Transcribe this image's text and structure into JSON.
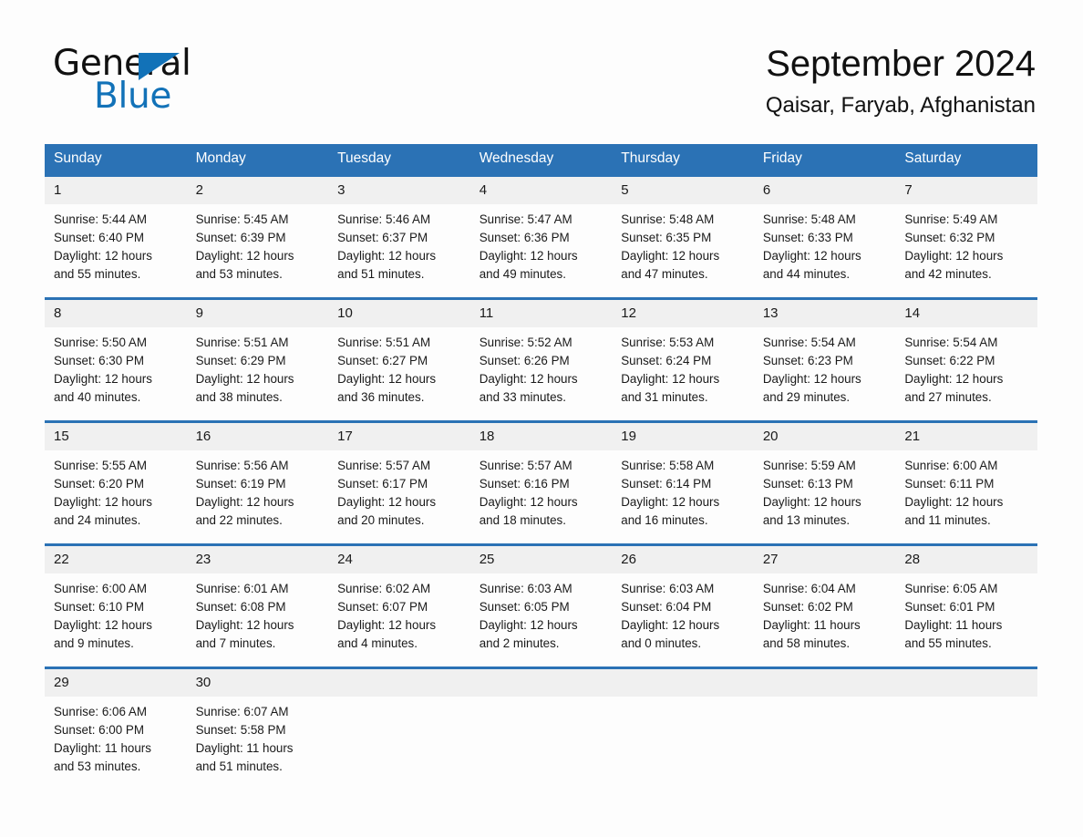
{
  "brand": {
    "name_part1": "General",
    "name_part2": "Blue",
    "triangle_color": "#1272b8"
  },
  "header": {
    "title": "September 2024",
    "location": "Qaisar, Faryab, Afghanistan"
  },
  "theme": {
    "header_blue": "#2b72b5",
    "date_band": "#f0f0f0",
    "page_background": "#fdfdfd",
    "text": "#1a1a1a"
  },
  "weekday_headers": [
    "Sunday",
    "Monday",
    "Tuesday",
    "Wednesday",
    "Thursday",
    "Friday",
    "Saturday"
  ],
  "weeks": [
    {
      "days": [
        {
          "date": "1",
          "sunrise": "Sunrise: 5:44 AM",
          "sunset": "Sunset: 6:40 PM",
          "daylight_line1": "Daylight: 12 hours",
          "daylight_line2": "and 55 minutes."
        },
        {
          "date": "2",
          "sunrise": "Sunrise: 5:45 AM",
          "sunset": "Sunset: 6:39 PM",
          "daylight_line1": "Daylight: 12 hours",
          "daylight_line2": "and 53 minutes."
        },
        {
          "date": "3",
          "sunrise": "Sunrise: 5:46 AM",
          "sunset": "Sunset: 6:37 PM",
          "daylight_line1": "Daylight: 12 hours",
          "daylight_line2": "and 51 minutes."
        },
        {
          "date": "4",
          "sunrise": "Sunrise: 5:47 AM",
          "sunset": "Sunset: 6:36 PM",
          "daylight_line1": "Daylight: 12 hours",
          "daylight_line2": "and 49 minutes."
        },
        {
          "date": "5",
          "sunrise": "Sunrise: 5:48 AM",
          "sunset": "Sunset: 6:35 PM",
          "daylight_line1": "Daylight: 12 hours",
          "daylight_line2": "and 47 minutes."
        },
        {
          "date": "6",
          "sunrise": "Sunrise: 5:48 AM",
          "sunset": "Sunset: 6:33 PM",
          "daylight_line1": "Daylight: 12 hours",
          "daylight_line2": "and 44 minutes."
        },
        {
          "date": "7",
          "sunrise": "Sunrise: 5:49 AM",
          "sunset": "Sunset: 6:32 PM",
          "daylight_line1": "Daylight: 12 hours",
          "daylight_line2": "and 42 minutes."
        }
      ]
    },
    {
      "days": [
        {
          "date": "8",
          "sunrise": "Sunrise: 5:50 AM",
          "sunset": "Sunset: 6:30 PM",
          "daylight_line1": "Daylight: 12 hours",
          "daylight_line2": "and 40 minutes."
        },
        {
          "date": "9",
          "sunrise": "Sunrise: 5:51 AM",
          "sunset": "Sunset: 6:29 PM",
          "daylight_line1": "Daylight: 12 hours",
          "daylight_line2": "and 38 minutes."
        },
        {
          "date": "10",
          "sunrise": "Sunrise: 5:51 AM",
          "sunset": "Sunset: 6:27 PM",
          "daylight_line1": "Daylight: 12 hours",
          "daylight_line2": "and 36 minutes."
        },
        {
          "date": "11",
          "sunrise": "Sunrise: 5:52 AM",
          "sunset": "Sunset: 6:26 PM",
          "daylight_line1": "Daylight: 12 hours",
          "daylight_line2": "and 33 minutes."
        },
        {
          "date": "12",
          "sunrise": "Sunrise: 5:53 AM",
          "sunset": "Sunset: 6:24 PM",
          "daylight_line1": "Daylight: 12 hours",
          "daylight_line2": "and 31 minutes."
        },
        {
          "date": "13",
          "sunrise": "Sunrise: 5:54 AM",
          "sunset": "Sunset: 6:23 PM",
          "daylight_line1": "Daylight: 12 hours",
          "daylight_line2": "and 29 minutes."
        },
        {
          "date": "14",
          "sunrise": "Sunrise: 5:54 AM",
          "sunset": "Sunset: 6:22 PM",
          "daylight_line1": "Daylight: 12 hours",
          "daylight_line2": "and 27 minutes."
        }
      ]
    },
    {
      "days": [
        {
          "date": "15",
          "sunrise": "Sunrise: 5:55 AM",
          "sunset": "Sunset: 6:20 PM",
          "daylight_line1": "Daylight: 12 hours",
          "daylight_line2": "and 24 minutes."
        },
        {
          "date": "16",
          "sunrise": "Sunrise: 5:56 AM",
          "sunset": "Sunset: 6:19 PM",
          "daylight_line1": "Daylight: 12 hours",
          "daylight_line2": "and 22 minutes."
        },
        {
          "date": "17",
          "sunrise": "Sunrise: 5:57 AM",
          "sunset": "Sunset: 6:17 PM",
          "daylight_line1": "Daylight: 12 hours",
          "daylight_line2": "and 20 minutes."
        },
        {
          "date": "18",
          "sunrise": "Sunrise: 5:57 AM",
          "sunset": "Sunset: 6:16 PM",
          "daylight_line1": "Daylight: 12 hours",
          "daylight_line2": "and 18 minutes."
        },
        {
          "date": "19",
          "sunrise": "Sunrise: 5:58 AM",
          "sunset": "Sunset: 6:14 PM",
          "daylight_line1": "Daylight: 12 hours",
          "daylight_line2": "and 16 minutes."
        },
        {
          "date": "20",
          "sunrise": "Sunrise: 5:59 AM",
          "sunset": "Sunset: 6:13 PM",
          "daylight_line1": "Daylight: 12 hours",
          "daylight_line2": "and 13 minutes."
        },
        {
          "date": "21",
          "sunrise": "Sunrise: 6:00 AM",
          "sunset": "Sunset: 6:11 PM",
          "daylight_line1": "Daylight: 12 hours",
          "daylight_line2": "and 11 minutes."
        }
      ]
    },
    {
      "days": [
        {
          "date": "22",
          "sunrise": "Sunrise: 6:00 AM",
          "sunset": "Sunset: 6:10 PM",
          "daylight_line1": "Daylight: 12 hours",
          "daylight_line2": "and 9 minutes."
        },
        {
          "date": "23",
          "sunrise": "Sunrise: 6:01 AM",
          "sunset": "Sunset: 6:08 PM",
          "daylight_line1": "Daylight: 12 hours",
          "daylight_line2": "and 7 minutes."
        },
        {
          "date": "24",
          "sunrise": "Sunrise: 6:02 AM",
          "sunset": "Sunset: 6:07 PM",
          "daylight_line1": "Daylight: 12 hours",
          "daylight_line2": "and 4 minutes."
        },
        {
          "date": "25",
          "sunrise": "Sunrise: 6:03 AM",
          "sunset": "Sunset: 6:05 PM",
          "daylight_line1": "Daylight: 12 hours",
          "daylight_line2": "and 2 minutes."
        },
        {
          "date": "26",
          "sunrise": "Sunrise: 6:03 AM",
          "sunset": "Sunset: 6:04 PM",
          "daylight_line1": "Daylight: 12 hours",
          "daylight_line2": "and 0 minutes."
        },
        {
          "date": "27",
          "sunrise": "Sunrise: 6:04 AM",
          "sunset": "Sunset: 6:02 PM",
          "daylight_line1": "Daylight: 11 hours",
          "daylight_line2": "and 58 minutes."
        },
        {
          "date": "28",
          "sunrise": "Sunrise: 6:05 AM",
          "sunset": "Sunset: 6:01 PM",
          "daylight_line1": "Daylight: 11 hours",
          "daylight_line2": "and 55 minutes."
        }
      ]
    },
    {
      "days": [
        {
          "date": "29",
          "sunrise": "Sunrise: 6:06 AM",
          "sunset": "Sunset: 6:00 PM",
          "daylight_line1": "Daylight: 11 hours",
          "daylight_line2": "and 53 minutes."
        },
        {
          "date": "30",
          "sunrise": "Sunrise: 6:07 AM",
          "sunset": "Sunset: 5:58 PM",
          "daylight_line1": "Daylight: 11 hours",
          "daylight_line2": "and 51 minutes."
        },
        {
          "date": "",
          "sunrise": "",
          "sunset": "",
          "daylight_line1": "",
          "daylight_line2": ""
        },
        {
          "date": "",
          "sunrise": "",
          "sunset": "",
          "daylight_line1": "",
          "daylight_line2": ""
        },
        {
          "date": "",
          "sunrise": "",
          "sunset": "",
          "daylight_line1": "",
          "daylight_line2": ""
        },
        {
          "date": "",
          "sunrise": "",
          "sunset": "",
          "daylight_line1": "",
          "daylight_line2": ""
        },
        {
          "date": "",
          "sunrise": "",
          "sunset": "",
          "daylight_line1": "",
          "daylight_line2": ""
        }
      ]
    }
  ]
}
